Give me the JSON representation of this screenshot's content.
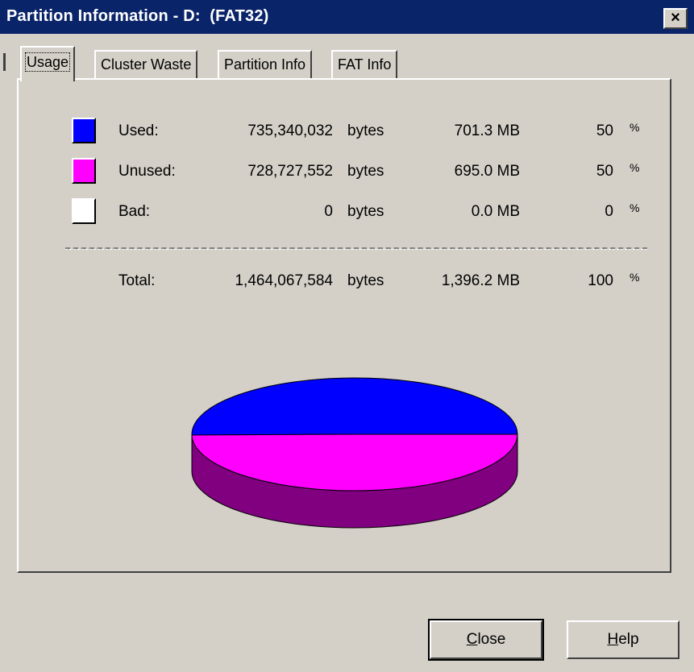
{
  "window": {
    "title": "Partition Information - D:  (FAT32)",
    "close_glyph": "×"
  },
  "tabs": [
    {
      "label": "Usage",
      "active": true
    },
    {
      "label": "Cluster Waste",
      "active": false
    },
    {
      "label": "Partition Info",
      "active": false
    },
    {
      "label": "FAT Info",
      "active": false
    }
  ],
  "usage": {
    "rows": [
      {
        "label": "Used:",
        "bytes": "735,340,032",
        "bytes_unit": "bytes",
        "mb": "701.3 MB",
        "percent": "50",
        "percent_sign": "%",
        "color": "#0000ff"
      },
      {
        "label": "Unused:",
        "bytes": "728,727,552",
        "bytes_unit": "bytes",
        "mb": "695.0 MB",
        "percent": "50",
        "percent_sign": "%",
        "color": "#ff00ff"
      },
      {
        "label": "Bad:",
        "bytes": "0",
        "bytes_unit": "bytes",
        "mb": "0.0 MB",
        "percent": "0",
        "percent_sign": "%",
        "color": "#ffffff"
      }
    ],
    "total": {
      "label": "Total:",
      "bytes": "1,464,067,584",
      "bytes_unit": "bytes",
      "mb": "1,396.2 MB",
      "percent": "100",
      "percent_sign": "%"
    }
  },
  "chart_data": {
    "type": "pie",
    "categories": [
      "Used",
      "Unused",
      "Bad"
    ],
    "values": [
      735340032,
      728727552,
      0
    ],
    "colors": [
      "#0000ff",
      "#ff00ff",
      "#ffffff"
    ],
    "side_color": "#800080"
  },
  "buttons": {
    "close_label_hotkey": "C",
    "close_label_rest": "lose",
    "help_label_hotkey": "H",
    "help_label_rest": "elp"
  }
}
